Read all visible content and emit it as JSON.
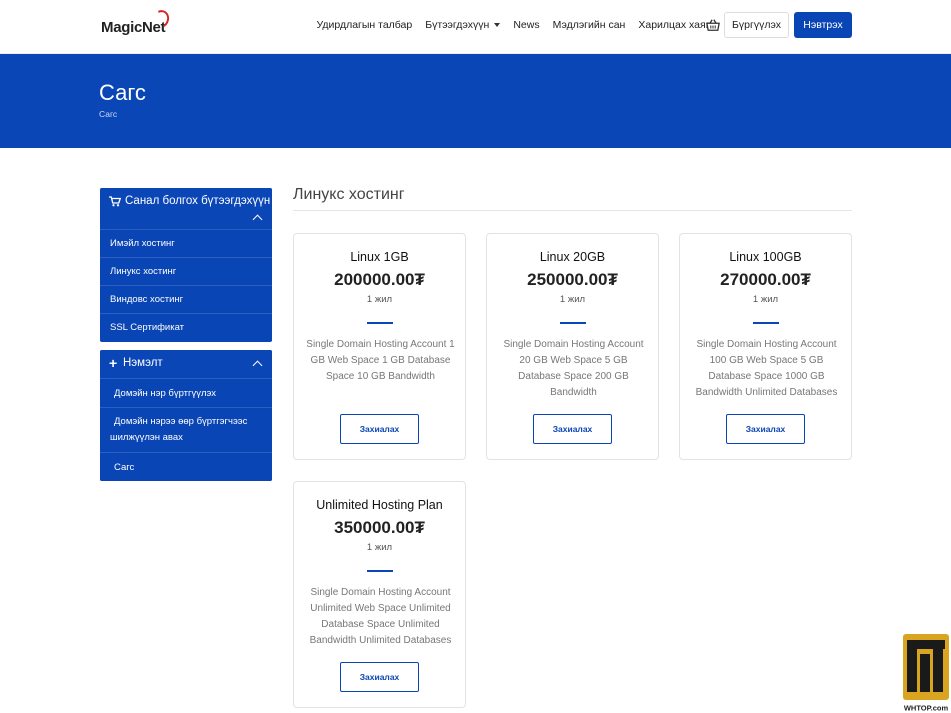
{
  "header": {
    "logo_text": "MagicNet",
    "nav": [
      {
        "label": "Удирдлагын талбар",
        "dropdown": false
      },
      {
        "label": "Бүтээгдэхүүн",
        "dropdown": true
      },
      {
        "label": "News",
        "dropdown": false
      },
      {
        "label": "Мэдлэгийн сан",
        "dropdown": false
      },
      {
        "label": "Харилцах хаяг",
        "dropdown": false
      }
    ],
    "cart_icon": "basket-icon",
    "register_label": "Бүргүүлэх",
    "login_label": "Нэвтрэх"
  },
  "banner": {
    "title": "Сагс",
    "breadcrumb": "Сагс"
  },
  "sidebar": {
    "categories": {
      "title": "Санал болгох бүтээгдэхүүн",
      "icon": "cart-icon",
      "items": [
        "Имэйл хостинг",
        "Линукс хостинг",
        "Виндовс хостинг",
        "SSL Сертификат"
      ]
    },
    "extras": {
      "title": "Нэмэлт",
      "icon": "plus-icon",
      "items": [
        "Домэйн нэр бүртгүүлэх",
        "Домэйн нэрээ өөр бүртгэгчээс шилжүүлэн авах",
        "Сагс"
      ]
    }
  },
  "main": {
    "section_title": "Линукс хостинг",
    "products": [
      {
        "name": "Linux 1GB",
        "price": "200000.00₮",
        "cycle": "1 жил",
        "description": "Single Domain Hosting Account 1 GB Web Space 1 GB Database Space 10 GB Bandwidth",
        "button": "Захиалах"
      },
      {
        "name": "Linux 20GB",
        "price": "250000.00₮",
        "cycle": "1 жил",
        "description": "Single Domain Hosting Account 20 GB Web Space 5 GB Database Space 200 GB Bandwidth",
        "button": "Захиалах"
      },
      {
        "name": "Linux 100GB",
        "price": "270000.00₮",
        "cycle": "1 жил",
        "description": "Single Domain Hosting Account 100 GB Web Space 5 GB Database Space 1000 GB Bandwidth Unlimited Databases",
        "button": "Захиалах"
      },
      {
        "name": "Unlimited Hosting Plan",
        "price": "350000.00₮",
        "cycle": "1 жил",
        "description": "Single Domain Hosting Account Unlimited Web Space Unlimited Database Space Unlimited Bandwidth Unlimited Databases",
        "button": "Захиалах"
      }
    ]
  },
  "watermark": {
    "text": "WHTOP.com"
  },
  "colors": {
    "brand_blue": "#0b46b6",
    "logo_red": "#d7262b"
  }
}
